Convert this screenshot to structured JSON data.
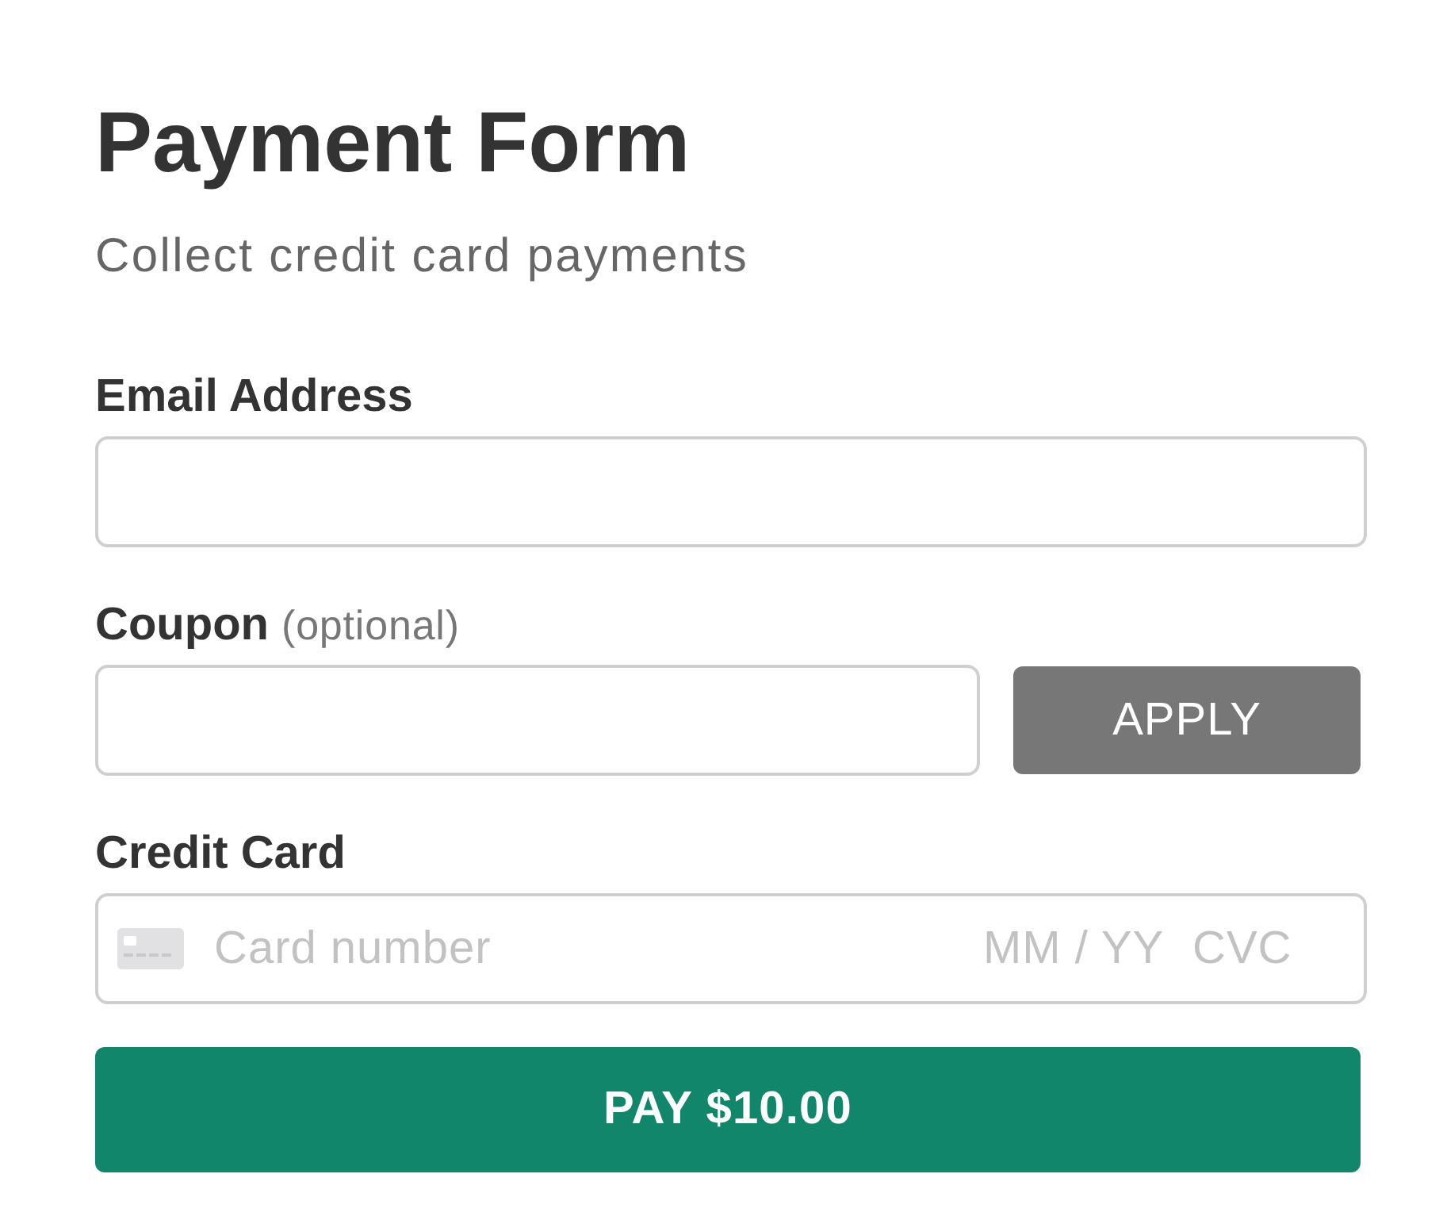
{
  "title": "Payment Form",
  "subtitle": "Collect credit card payments",
  "fields": [
    {
      "kind": "text",
      "label": "Email Address"
    },
    {
      "kind": "coupon",
      "label": "Coupon",
      "hint": "(optional)",
      "button": "APPLY"
    },
    {
      "kind": "card",
      "label": "Credit Card",
      "placeholder": "Card number",
      "expiry_placeholder": "MM / YY",
      "cvc_placeholder": "CVC"
    }
  ],
  "submit": "PAY $10.00"
}
